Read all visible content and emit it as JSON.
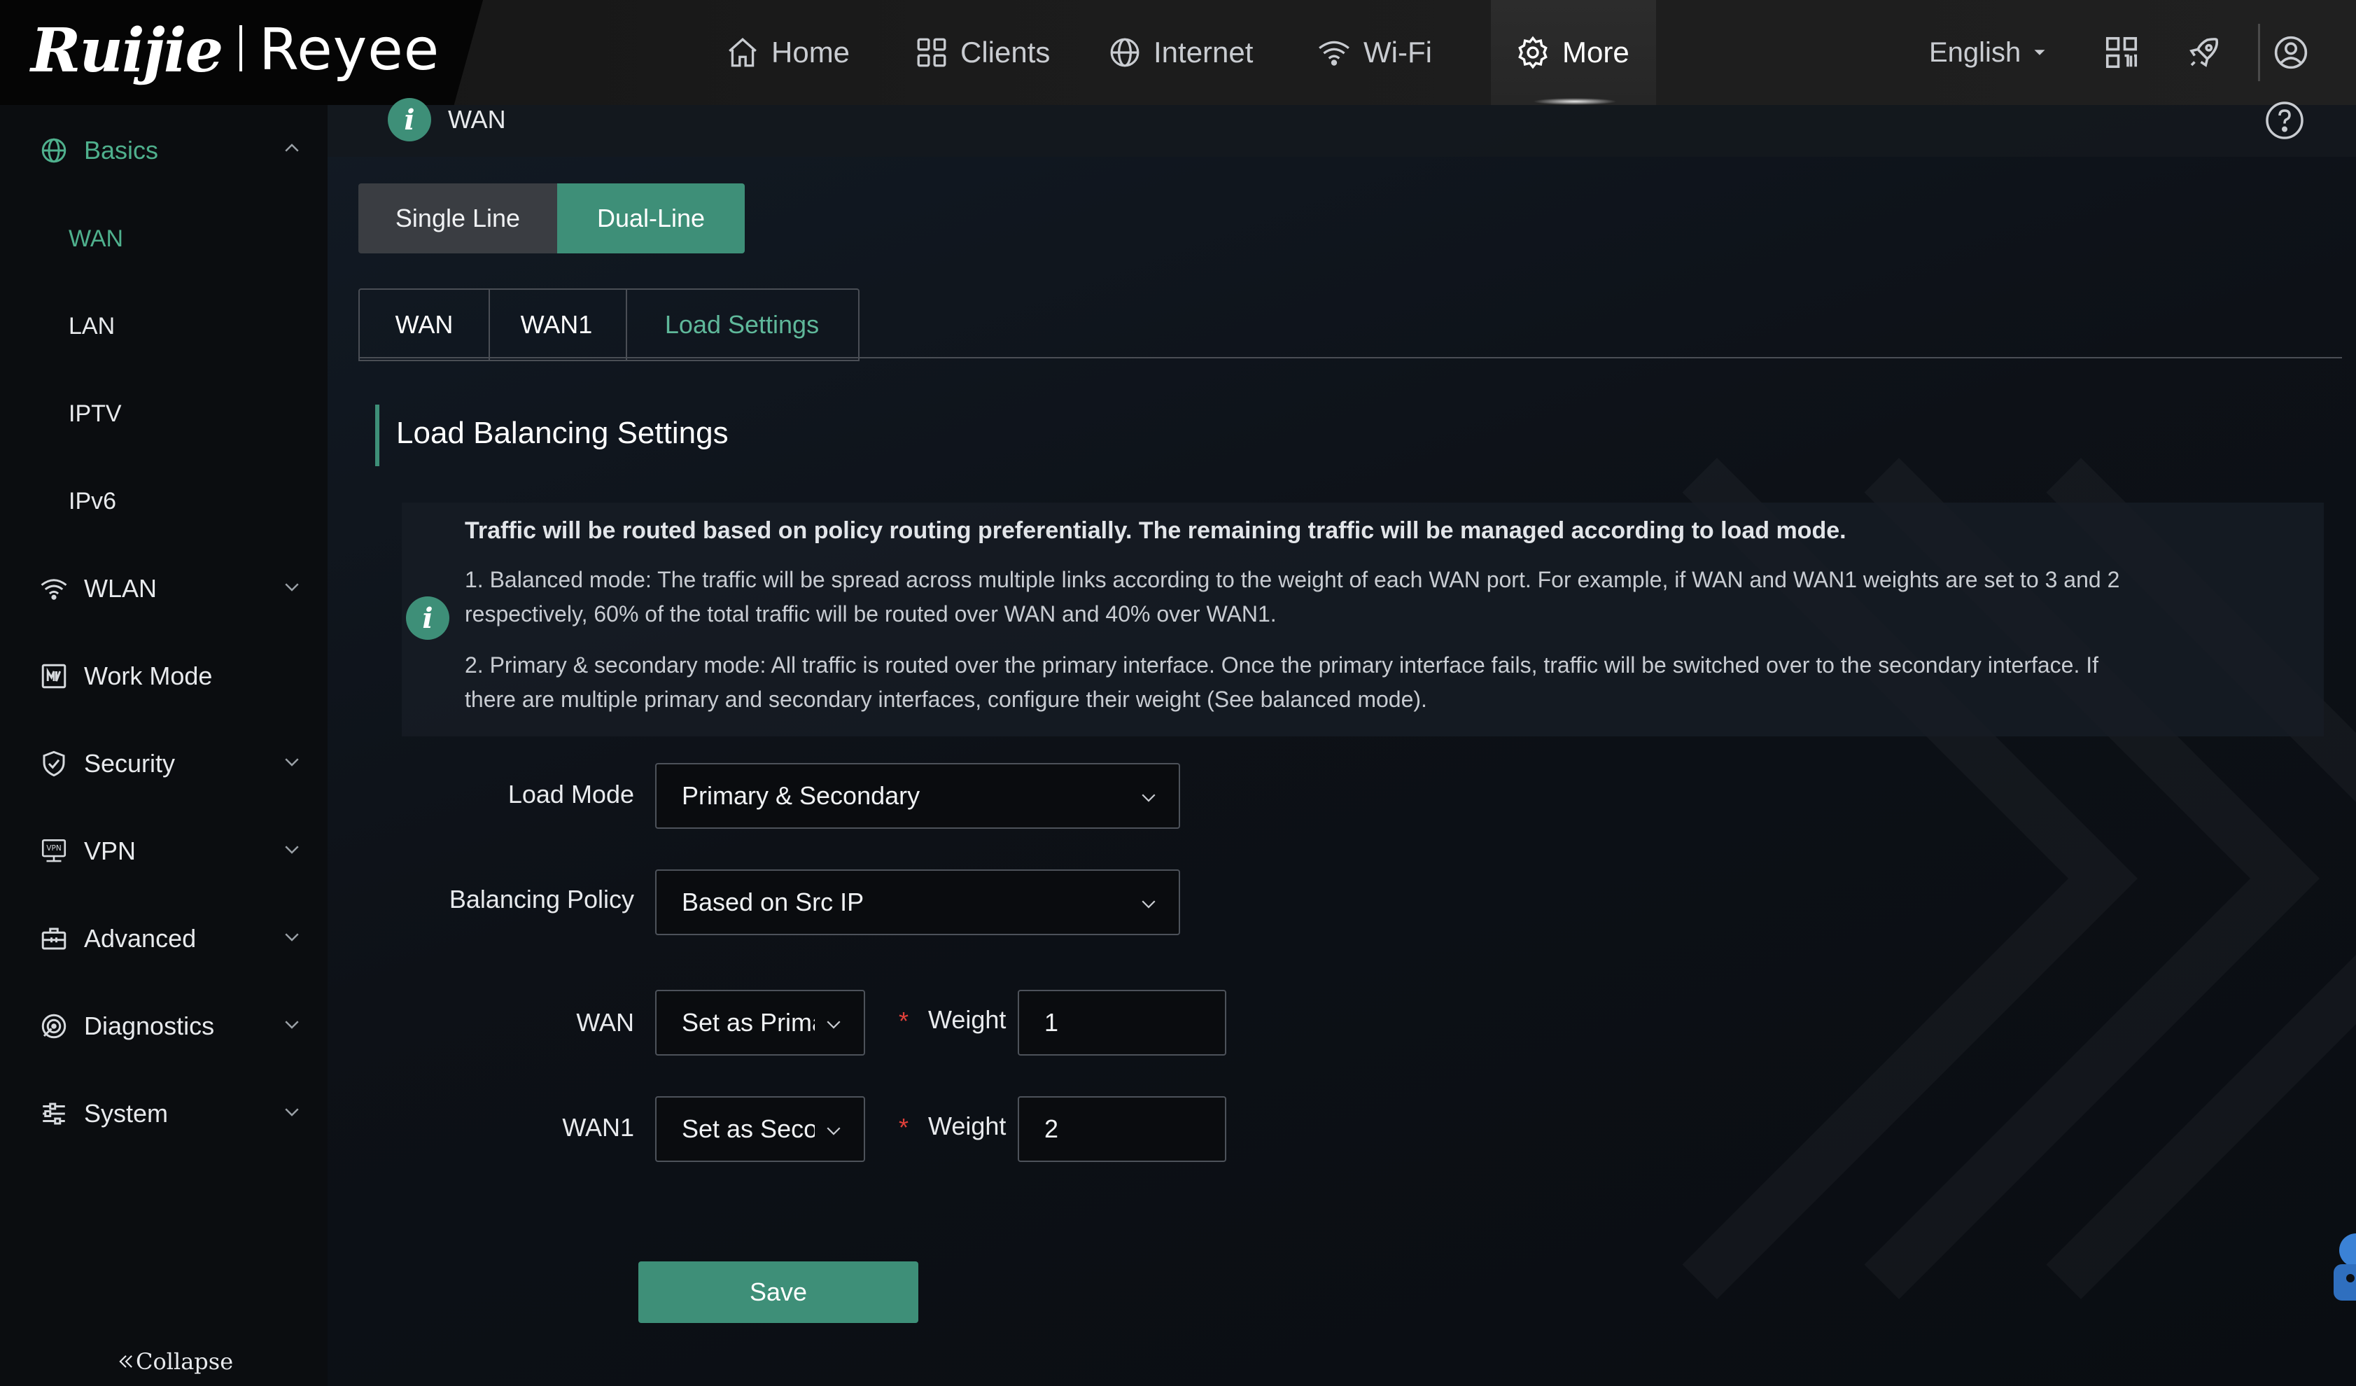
{
  "brand": {
    "logo_left": "Ruijie",
    "logo_right": "Reyee"
  },
  "nav": {
    "home": "Home",
    "clients": "Clients",
    "internet": "Internet",
    "wifi": "Wi-Fi",
    "more": "More",
    "language": "English"
  },
  "sidebar": {
    "basics": "Basics",
    "sub": [
      "WAN",
      "LAN",
      "IPTV",
      "IPv6"
    ],
    "wlan": "WLAN",
    "work_mode": "Work Mode",
    "security": "Security",
    "vpn": "VPN",
    "advanced": "Advanced",
    "diagnostics": "Diagnostics",
    "system": "System",
    "collapse": "Collapse"
  },
  "page": {
    "title": "WAN",
    "line_modes": [
      "Single Line",
      "Dual-Line"
    ],
    "tabs": [
      "WAN",
      "WAN1",
      "Load Settings"
    ],
    "section_title": "Load Balancing Settings",
    "info": {
      "heading": "Traffic will be routed based on policy routing preferentially. The remaining traffic will be managed according to load mode.",
      "line1a": "1. Balanced mode: The traffic will be spread across multiple links according to the weight of each WAN port. For example, if WAN and WAN1 weights are set to 3 and 2",
      "line1b": "respectively, 60% of the total traffic will be routed over WAN and 40% over WAN1.",
      "line2a": "2. Primary & secondary mode: All traffic is routed over the primary interface. Once the primary interface fails, traffic will be switched over to the secondary interface. If",
      "line2b": "there are multiple primary and secondary interfaces, configure their weight (See balanced mode)."
    },
    "form": {
      "load_mode_label": "Load Mode",
      "load_mode_value": "Primary & Secondary",
      "policy_label": "Balancing Policy",
      "policy_value": "Based on Src IP",
      "wan_label": "WAN",
      "wan_role": "Set as Primary",
      "wan1_label": "WAN1",
      "wan1_role": "Set as Secondary",
      "weight_label": "Weight",
      "required_mark": "*",
      "wan_weight": "1",
      "wan1_weight": "2"
    },
    "save": "Save"
  },
  "colors": {
    "accent": "#3e8f78",
    "accent_text": "#5fb89a",
    "required": "#e0403a"
  }
}
